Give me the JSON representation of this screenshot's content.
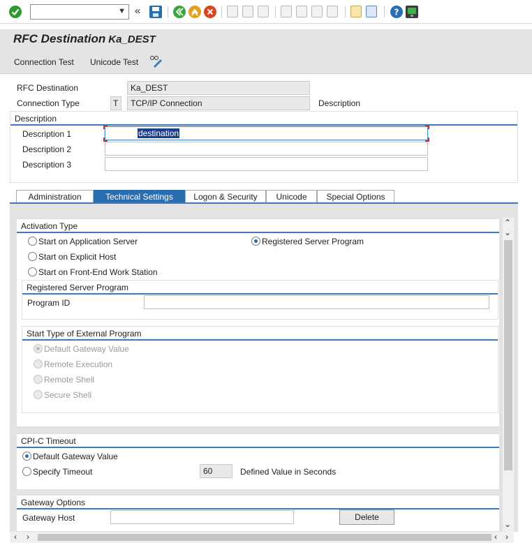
{
  "toolbar": {
    "enter_icon": "check-circle-icon",
    "command_field_value": "",
    "icons": [
      "save-icon",
      "back-icon",
      "exit-icon",
      "cancel-icon",
      "print-icon",
      "find-icon",
      "find-next-icon",
      "first-page-icon",
      "prev-page-icon",
      "next-page-icon",
      "last-page-icon",
      "new-session-icon",
      "shortcut-icon",
      "help-icon",
      "customize-layout-icon"
    ],
    "colors": {
      "enter": "#2e9a2e",
      "back": "#3aa53a",
      "exit": "#e0a020",
      "cancel": "#d9451f",
      "save": "#2b6eb0",
      "help": "#2b6eb0"
    }
  },
  "title": {
    "label": "RFC Destination",
    "destination": "Ka_DEST"
  },
  "appbar": {
    "connection_test": "Connection Test",
    "unicode_test": "Unicode Test",
    "settings_icon": "glasses-pencil-icon"
  },
  "header": {
    "rfc_destination_label": "RFC Destination",
    "rfc_destination_value": "Ka_DEST",
    "connection_type_label": "Connection Type",
    "connection_type_code": "T",
    "connection_type_value": "TCP/IP Connection",
    "connection_type_description": "Description"
  },
  "description": {
    "title": "Description",
    "d1_label": "Description 1",
    "d1_value": "destination",
    "d2_label": "Description 2",
    "d2_value": "",
    "d3_label": "Description 3",
    "d3_value": ""
  },
  "tabs": [
    "Administration",
    "Technical Settings",
    "Logon & Security",
    "Unicode",
    "Special Options"
  ],
  "active_tab": "Technical Settings",
  "activation": {
    "title": "Activation Type",
    "opt_app_server": "Start on Application Server",
    "opt_registered": "Registered Server Program",
    "opt_explicit_host": "Start on Explicit Host",
    "opt_frontend": "Start on Front-End Work Station",
    "selected": "Registered Server Program"
  },
  "registered": {
    "title": "Registered Server Program",
    "program_id_label": "Program ID",
    "program_id_value": ""
  },
  "start_type": {
    "title": "Start Type of External Program",
    "opt_default": "Default Gateway Value",
    "opt_remote_exec": "Remote Execution",
    "opt_remote_shell": "Remote Shell",
    "opt_secure_shell": "Secure Shell",
    "selected": "Default Gateway Value"
  },
  "cpic": {
    "title": "CPI-C Timeout",
    "opt_default": "Default Gateway Value",
    "opt_specify": "Specify Timeout",
    "timeout_value": "60",
    "timeout_unit_label": "Defined Value in Seconds",
    "selected": "Default Gateway Value"
  },
  "gateway": {
    "title": "Gateway Options",
    "host_label": "Gateway Host",
    "host_value": "",
    "delete_label": "Delete"
  }
}
